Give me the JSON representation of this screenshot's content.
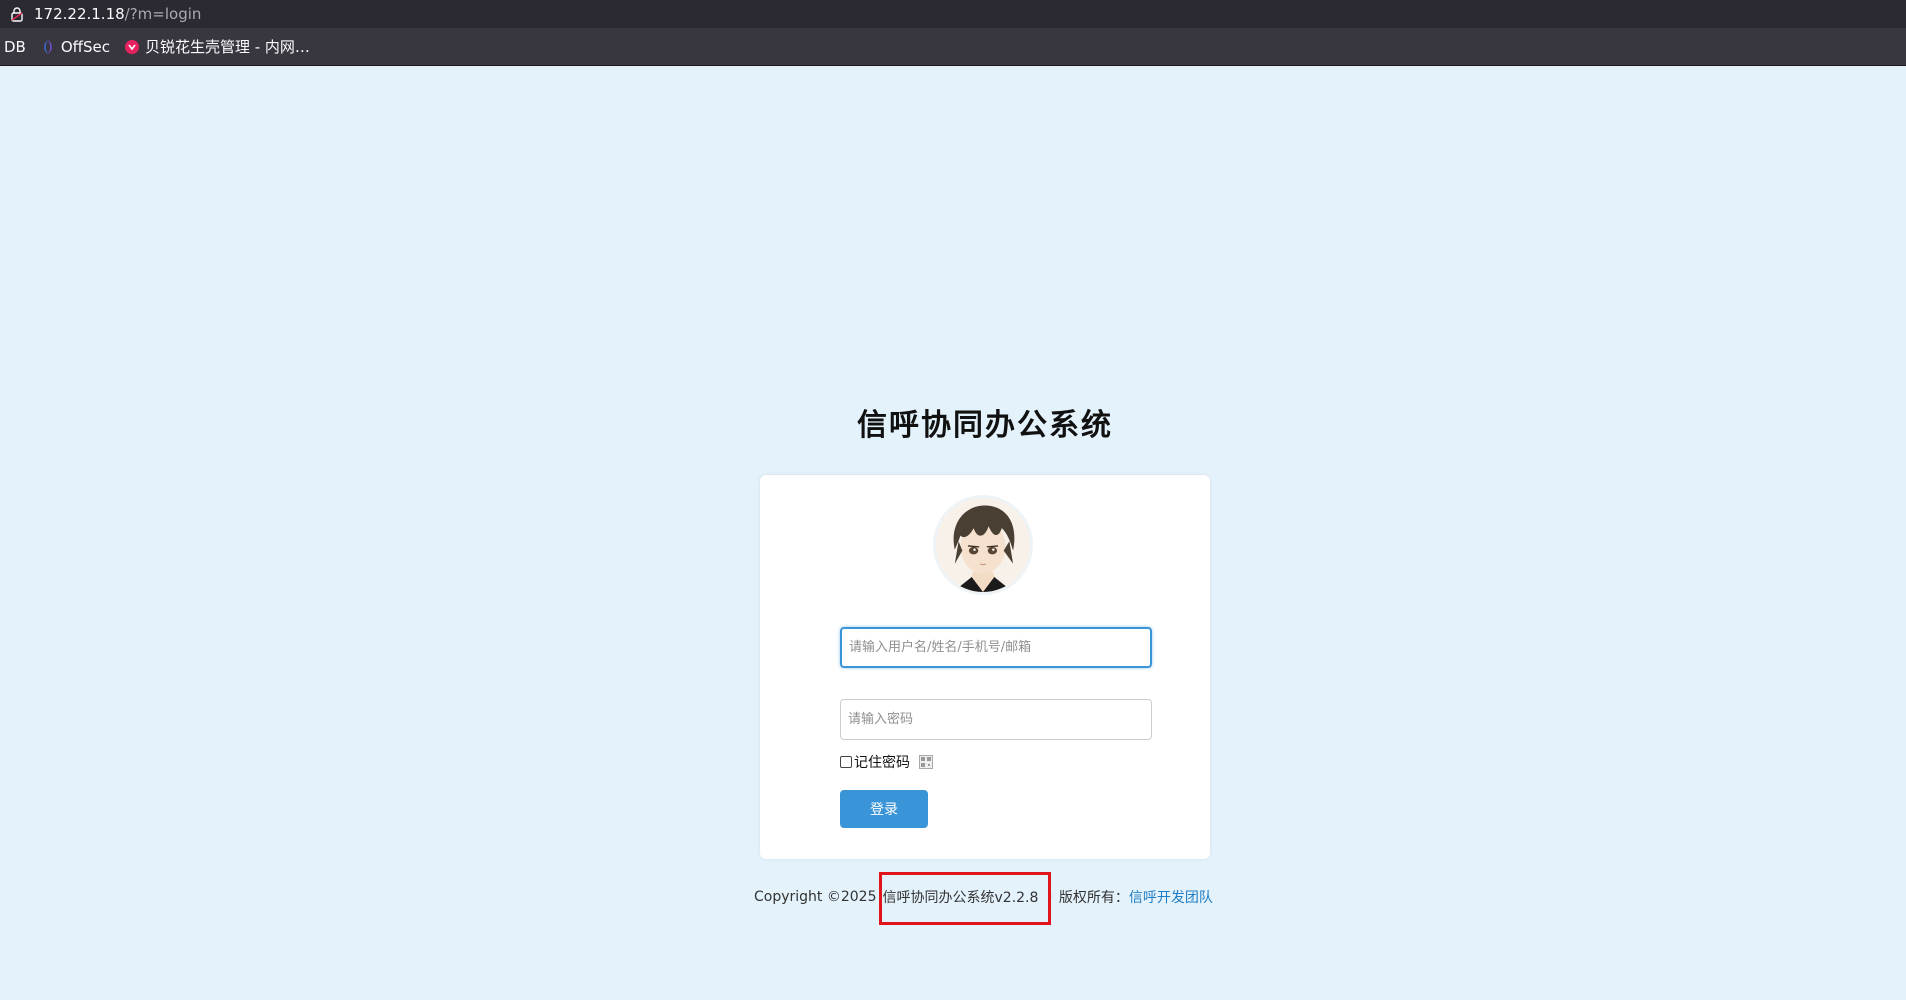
{
  "browser": {
    "url_host": "172.22.1.18",
    "url_path": "/?m=login",
    "bookmarks": [
      {
        "label": "DB",
        "icon": "none"
      },
      {
        "label": "OffSec",
        "icon": "offsec-icon"
      },
      {
        "label": "贝锐花生壳管理 - 内网…",
        "icon": "oray-icon"
      }
    ]
  },
  "page": {
    "title": "信呼协同办公系统",
    "username_placeholder": "请输入用户名/姓名/手机号/邮箱",
    "password_placeholder": "请输入密码",
    "remember_label": "记住密码",
    "login_label": "登录"
  },
  "footer": {
    "copyright": "Copyright ©2025",
    "product": "信呼协同办公系统v2.2.8",
    "separator": "·",
    "rights_label": "版权所有：",
    "team_link": "信呼开发团队"
  },
  "colors": {
    "background": "#e4f2fb",
    "accent": "#3a95d8",
    "link": "#1f7dc4",
    "highlight": "#e0141a"
  }
}
